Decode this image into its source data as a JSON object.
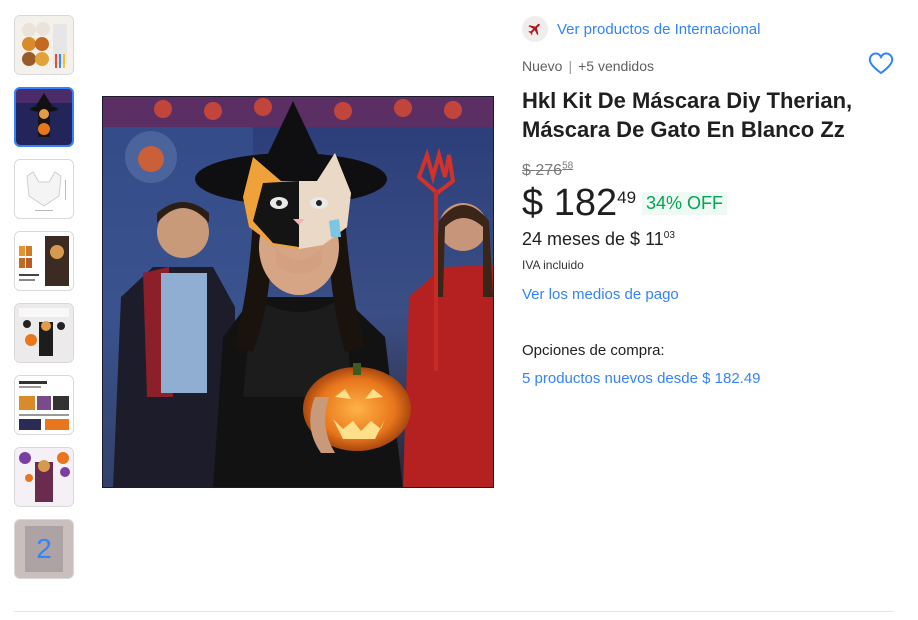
{
  "international": {
    "link": "Ver productos de Internacional",
    "icon": "airplane-icon"
  },
  "condition": {
    "status": "Nuevo",
    "separator": "|",
    "sold": "+5 vendidos"
  },
  "favorite": {
    "icon": "heart-outline-icon"
  },
  "title": "Hkl Kit De Máscara Diy Therian, Máscara De Gato En Blanco Zz",
  "old_price": {
    "currency": "$",
    "integer": "276",
    "cents": "58"
  },
  "price": {
    "currency": "$",
    "integer": "182",
    "cents": "49"
  },
  "discount": "34% OFF",
  "installments": {
    "text": "24 meses de $ 11",
    "cents": "03"
  },
  "tax_note": "IVA incluido",
  "payment_link": "Ver los medios de pago",
  "purchase_options": {
    "label": "Opciones de compra:",
    "link": "5 productos nuevos desde $ 182.49"
  },
  "thumbnails": {
    "more_count": "2",
    "selected_index": 1,
    "count": 8
  },
  "colors": {
    "link": "#3483fa",
    "discount": "#00a650",
    "badge_red": "#b3141d"
  }
}
